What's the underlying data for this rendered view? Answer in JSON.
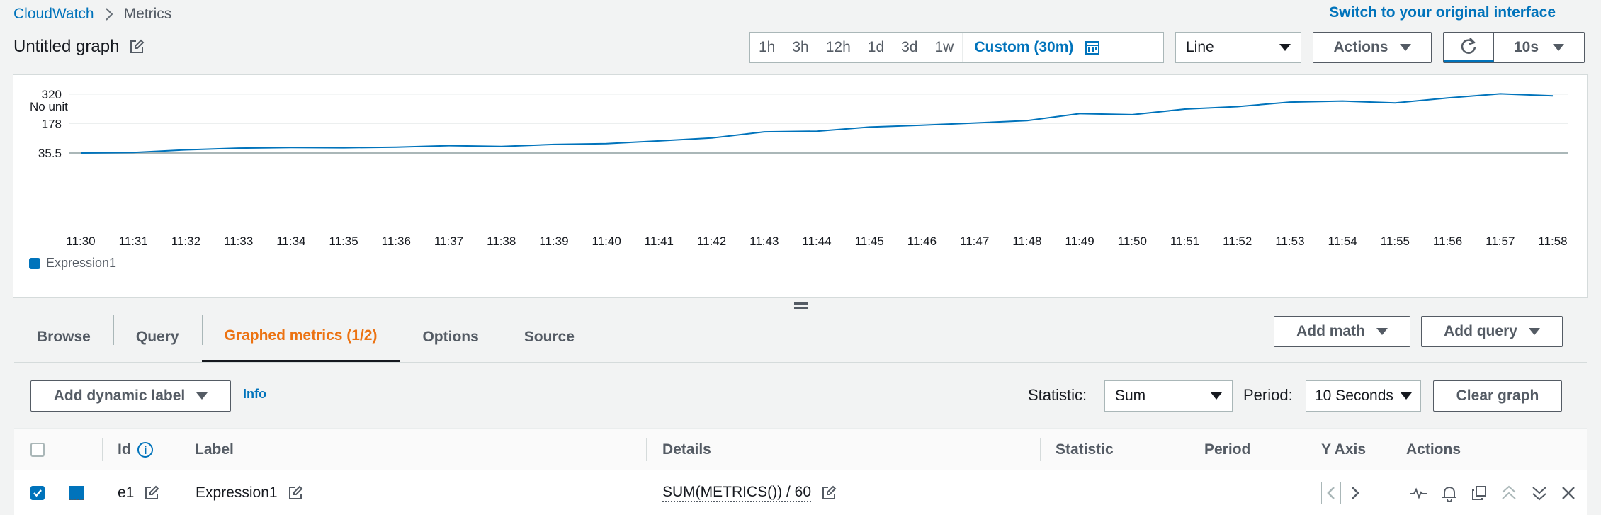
{
  "breadcrumb": {
    "home": "CloudWatch",
    "current": "Metrics"
  },
  "header": {
    "switch_link": "Switch to your original interface",
    "title": "Untitled graph"
  },
  "time_range": {
    "options": [
      "1h",
      "3h",
      "12h",
      "1d",
      "3d",
      "1w"
    ],
    "active": "Custom (30m)"
  },
  "controls": {
    "chart_type": "Line",
    "actions_label": "Actions",
    "refresh_interval": "10s"
  },
  "chart_data": {
    "type": "line",
    "unit_label": "No unit",
    "yticks": [
      "320",
      "178",
      "35.5"
    ],
    "ylim": [
      35.5,
      320
    ],
    "x": [
      "11:30",
      "11:31",
      "11:32",
      "11:33",
      "11:34",
      "11:35",
      "11:36",
      "11:37",
      "11:38",
      "11:39",
      "11:40",
      "11:41",
      "11:42",
      "11:43",
      "11:44",
      "11:45",
      "11:46",
      "11:47",
      "11:48",
      "11:49",
      "11:50",
      "11:51",
      "11:52",
      "11:53",
      "11:54",
      "11:55",
      "11:56",
      "11:57",
      "11:58"
    ],
    "series": [
      {
        "name": "Expression1",
        "color": "#0073bb",
        "values": [
          35.5,
          38,
          51,
          59,
          62,
          61,
          64,
          71,
          67,
          77,
          81,
          94,
          108,
          138,
          141,
          161,
          170,
          181,
          192,
          226,
          221,
          248,
          260,
          282,
          287,
          278,
          302,
          322,
          312
        ]
      }
    ],
    "grid": true,
    "legend": "bottom-left"
  },
  "tabs": [
    {
      "label": "Browse",
      "active": false
    },
    {
      "label": "Query",
      "active": false
    },
    {
      "label": "Graphed metrics (1/2)",
      "active": true
    },
    {
      "label": "Options",
      "active": false
    },
    {
      "label": "Source",
      "active": false
    }
  ],
  "tab_actions": {
    "add_math": "Add math",
    "add_query": "Add query"
  },
  "toolbar": {
    "dynamic_label": "Add dynamic label",
    "info": "Info",
    "statistic_label": "Statistic:",
    "statistic_value": "Sum",
    "period_label": "Period:",
    "period_value": "10 Seconds",
    "clear_graph": "Clear graph"
  },
  "table": {
    "headers": {
      "id": "Id",
      "label": "Label",
      "details": "Details",
      "statistic": "Statistic",
      "period": "Period",
      "y_axis": "Y Axis",
      "actions": "Actions"
    },
    "rows": [
      {
        "checked": true,
        "color": "#0073bb",
        "id": "e1",
        "label": "Expression1",
        "details": "SUM(METRICS()) / 60"
      }
    ]
  }
}
